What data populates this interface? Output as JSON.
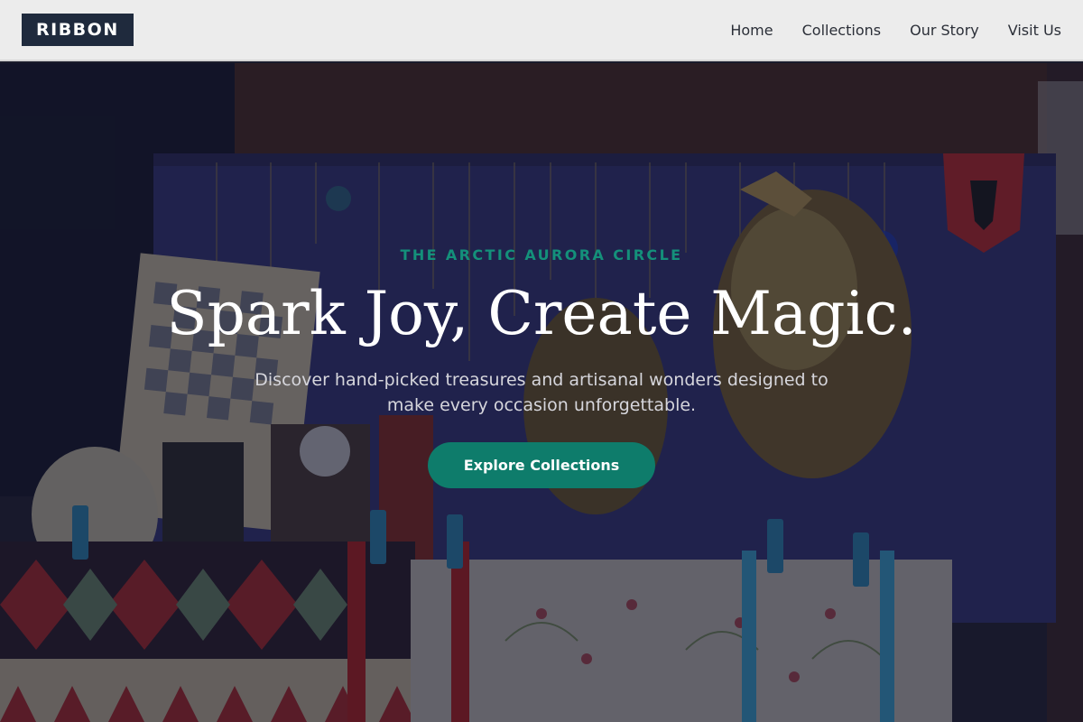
{
  "header": {
    "logo": "RIBBON",
    "nav": [
      {
        "label": "Home"
      },
      {
        "label": "Collections"
      },
      {
        "label": "Our Story"
      },
      {
        "label": "Visit Us"
      }
    ]
  },
  "hero": {
    "eyebrow": "THE ARCTIC AURORA CIRCLE",
    "headline": "Spark Joy, Create Magic.",
    "subtext": "Discover hand-picked treasures and artisanal wonders designed to make every occasion unforgettable.",
    "cta_label": "Explore Collections"
  },
  "colors": {
    "accent": "#0e7c6b",
    "eyebrow": "#14907a",
    "logo_bg": "#1f2a3d",
    "header_bg": "#ececec"
  }
}
